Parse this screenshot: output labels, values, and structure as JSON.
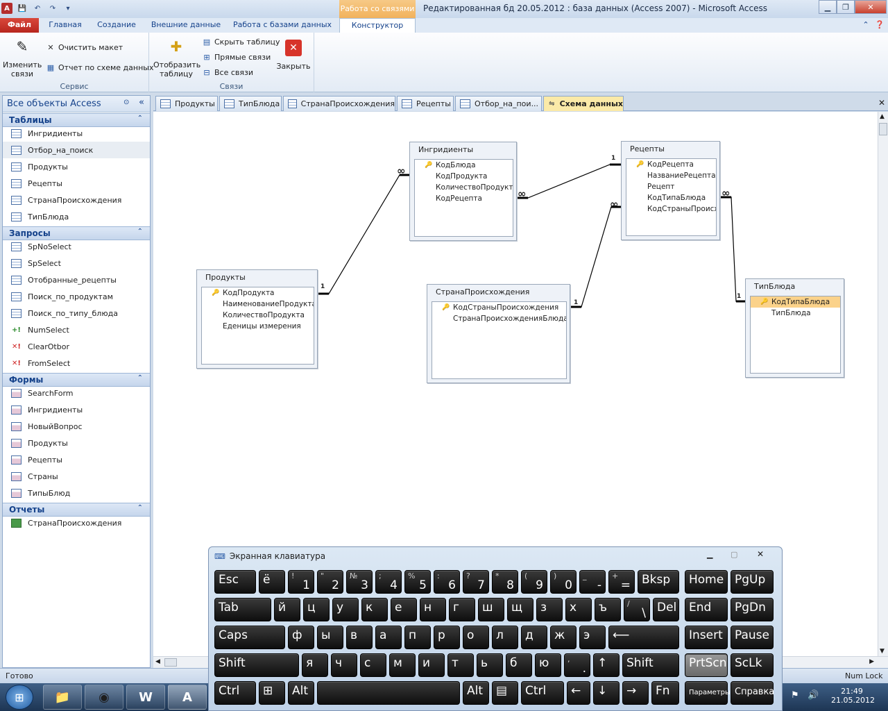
{
  "window": {
    "title": "Редактированная бд 20.05.2012 : база данных (Access 2007)  -  Microsoft Access",
    "context_group": "Работа со связями"
  },
  "ribbon_tabs": [
    "Файл",
    "Главная",
    "Создание",
    "Внешние данные",
    "Работа с базами данных",
    "Конструктор"
  ],
  "ribbon": {
    "group_service": {
      "label": "Сервис",
      "edit_links": "Изменить связи",
      "clear_layout": "Очистить макет",
      "report": "Отчет по схеме данных"
    },
    "group_links": {
      "label": "Связи",
      "show_table": "Отобразить таблицу",
      "hide_table": "Скрыть таблицу",
      "direct_links": "Прямые связи",
      "all_links": "Все связи",
      "close": "Закрыть"
    }
  },
  "nav": {
    "header": "Все объекты Access",
    "categories": [
      {
        "label": "Таблицы",
        "items": [
          "Ингридиенты",
          "Отбор_на_поиск",
          "Продукты",
          "Рецепты",
          "СтранаПроисхождения",
          "ТипБлюда"
        ]
      },
      {
        "label": "Запросы",
        "items": [
          "SpNoSelect",
          "SpSelect",
          "Отобранные_рецепты",
          "Поиск_по_продуктам",
          "Поиск_по_типу_блюда",
          "NumSelect",
          "ClearOtbor",
          "FromSelect"
        ]
      },
      {
        "label": "Формы",
        "items": [
          "SearchForm",
          "Ингридиенты",
          "НовыйВопрос",
          "Продукты",
          "Рецепты",
          "Страны",
          "ТипыБлюд"
        ]
      },
      {
        "label": "Отчеты",
        "items": [
          "СтранаПроисхождения"
        ]
      }
    ]
  },
  "doc_tabs": [
    "Продукты",
    "ТипБлюда",
    "СтранаПроисхождения",
    "Рецепты",
    "Отбор_на_пои...",
    "Схема данных"
  ],
  "tables": {
    "ingr": {
      "title": "Ингридиенты",
      "fields": [
        "КодБлюда",
        "КодПродукта",
        "КоличествоПродукта",
        "КодРецепта"
      ]
    },
    "recipes": {
      "title": "Рецепты",
      "fields": [
        "КодРецепта",
        "НазваниеРецепта",
        "Рецепт",
        "КодТипаБлюда",
        "КодСтраныПроисх"
      ]
    },
    "products": {
      "title": "Продукты",
      "fields": [
        "КодПродукта",
        "НаименованиеПродукта",
        "КоличествоПродукта",
        "Еденицы измерения"
      ]
    },
    "country": {
      "title": "СтранаПроисхождения",
      "fields": [
        "КодСтраныПроисхождения",
        "СтранаПроисхожденияБлюда"
      ]
    },
    "dish": {
      "title": "ТипБлюда",
      "fields": [
        "КодТипаБлюда",
        "ТипБлюда"
      ]
    }
  },
  "relation_labels": {
    "one": "1",
    "many": "∞"
  },
  "status": {
    "left": "Готово",
    "right": "Num Lock"
  },
  "clock": {
    "time": "21:49",
    "date": "21.05.2012"
  },
  "osk": {
    "title": "Экранная клавиатура",
    "keys": {
      "esc": "Esc",
      "yo": "ё",
      "k1m": "1",
      "k1s": "!",
      "k2m": "2",
      "k2s": "\"",
      "k3m": "3",
      "k3s": "№",
      "k4m": "4",
      "k4s": ";",
      "k5m": "5",
      "k5s": "%",
      "k6m": "6",
      "k6s": ":",
      "k7m": "7",
      "k7s": "?",
      "k8m": "8",
      "k8s": "*",
      "k9m": "9",
      "k9s": "(",
      "k0m": "0",
      "k0s": ")",
      "kminm": "-",
      "kmins": "_",
      "keqm": "=",
      "keqs": "+",
      "bksp": "Bksp",
      "home": "Home",
      "pgup": "PgUp",
      "tab": "Tab",
      "r1": "й",
      "r2": "ц",
      "r3": "у",
      "r4": "к",
      "r5": "е",
      "r6": "н",
      "r7": "г",
      "r8": "ш",
      "r9": "щ",
      "r10": "з",
      "r11": "х",
      "r12": "ъ",
      "bslm": "\\",
      "bsls": "/",
      "del": "Del",
      "end": "End",
      "pgdn": "PgDn",
      "caps": "Caps",
      "a1": "ф",
      "a2": "ы",
      "a3": "в",
      "a4": "а",
      "a5": "п",
      "a6": "р",
      "a7": "о",
      "a8": "л",
      "a9": "д",
      "a10": "ж",
      "a11": "э",
      "enter": "⟵",
      "insert": "Insert",
      "pause": "Pause",
      "shift": "Shift",
      "z1": "я",
      "z2": "ч",
      "z3": "с",
      "z4": "м",
      "z5": "и",
      "z6": "т",
      "z7": "ь",
      "z8": "б",
      "z9": "ю",
      "dotm": ".",
      "dots": ",",
      "up": "↑",
      "shift2": "Shift",
      "prtscn": "PrtScn",
      "sclk": "ScLk",
      "ctrl": "Ctrl",
      "win": "⊞",
      "alt": "Alt",
      "alt2": "Alt",
      "menu": "▤",
      "ctrl2": "Ctrl",
      "left": "←",
      "down": "↓",
      "right": "→",
      "fn": "Fn",
      "params": "Параметры",
      "help": "Справка"
    }
  }
}
